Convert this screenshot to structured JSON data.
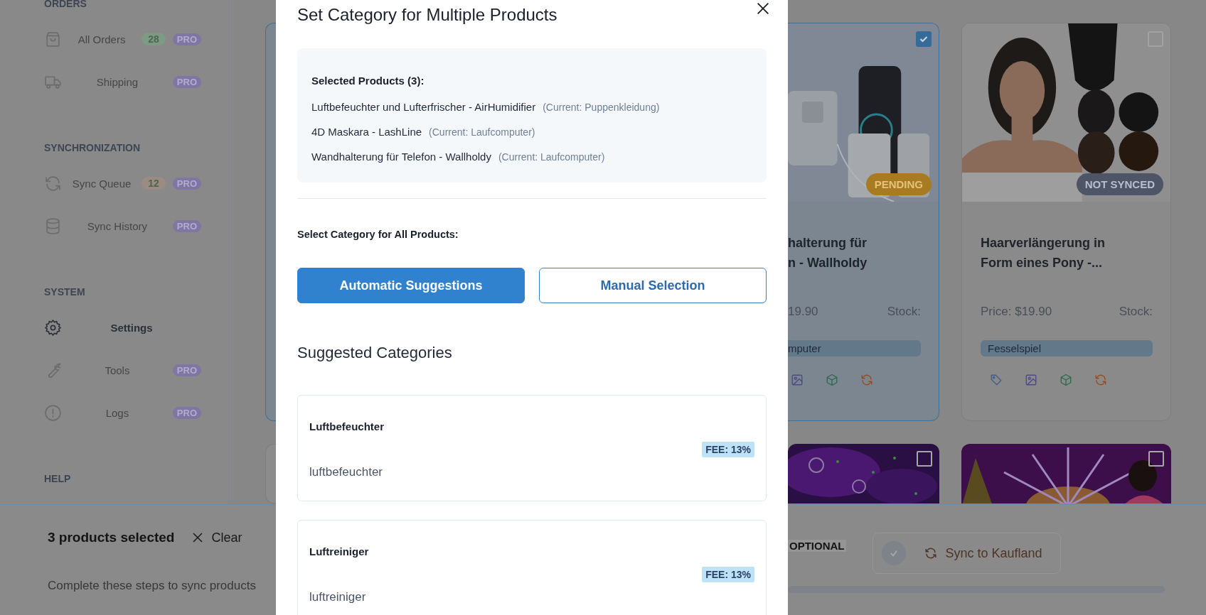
{
  "sidebar": {
    "sections": [
      {
        "title": "ORDERS",
        "items": [
          {
            "label": "All Orders",
            "selected": false,
            "count": {
              "text": "28",
              "color": "#7d9a84"
            },
            "badge": "PRO"
          },
          {
            "label": "Shipping",
            "selected": false,
            "badge": "PRO"
          }
        ]
      },
      {
        "title": "SYNCHRONIZATION",
        "items": [
          {
            "label": "Sync Queue",
            "selected": false,
            "count": {
              "text": "12",
              "color": "#9c8b80"
            },
            "badge": "PRO"
          },
          {
            "label": "Sync History",
            "selected": false,
            "badge": "PRO"
          }
        ]
      },
      {
        "title": "SYSTEM",
        "items": [
          {
            "label": "Settings",
            "selected": true
          },
          {
            "label": "Tools",
            "selected": false,
            "badge": "PRO"
          },
          {
            "label": "Logs",
            "selected": false,
            "badge": "PRO"
          }
        ]
      },
      {
        "title": "HELP"
      }
    ]
  },
  "product_cards": [
    {
      "kind": "partial",
      "checked": true,
      "status": {
        "text": "PENDING",
        "color": "#a87b22"
      },
      "title_lines": [
        "halterung für",
        "n - Wallholdy"
      ],
      "price": "19.90",
      "stock": "Stock:",
      "category": "mputer"
    },
    {
      "kind": "full",
      "checked": false,
      "status": {
        "text": "NOT SYNCED",
        "color": "#4d5566"
      },
      "title_lines": [
        "Haarverlängerung in",
        "Form eines Pony -..."
      ],
      "price": "Price: $19.90",
      "stock": "Stock:",
      "category": "Fesselspiel"
    }
  ],
  "more_cards": [
    {
      "checked": false
    },
    {
      "checked": false
    }
  ],
  "bottom_bar": {
    "selection": "3 products selected",
    "clear": "Clear",
    "hint": "Complete these steps to sync products",
    "step_label": "OPTIONAL",
    "sync_button": {
      "label": "Sync to Kaufland",
      "disabled": true
    }
  },
  "modal": {
    "title": "Set Category for Multiple Products",
    "selected_heading": "Selected Products (3):",
    "selected_products": [
      {
        "name": "Luftbefeuchter und Lufterfrischer - AirHumidifier",
        "current": "(Current: Puppenkleidung)"
      },
      {
        "name": "4D Maskara - LashLine",
        "current": "(Current: Laufcomputer)"
      },
      {
        "name": "Wandhalterung für Telefon - Wallholdy",
        "current": "(Current: Laufcomputer)"
      }
    ],
    "select_label": "Select Category for All Products:",
    "modes": [
      {
        "label": "Automatic Suggestions",
        "selected": true
      },
      {
        "label": "Manual Selection",
        "selected": false
      }
    ],
    "suggestions_heading": "Suggested Categories",
    "suggestions": [
      {
        "name": "Luftbefeuchter",
        "fee": "FEE: 13%",
        "slug": "luftbefeuchter"
      },
      {
        "name": "Luftreiniger",
        "fee": "FEE: 13%",
        "slug": "luftreiniger"
      }
    ]
  }
}
